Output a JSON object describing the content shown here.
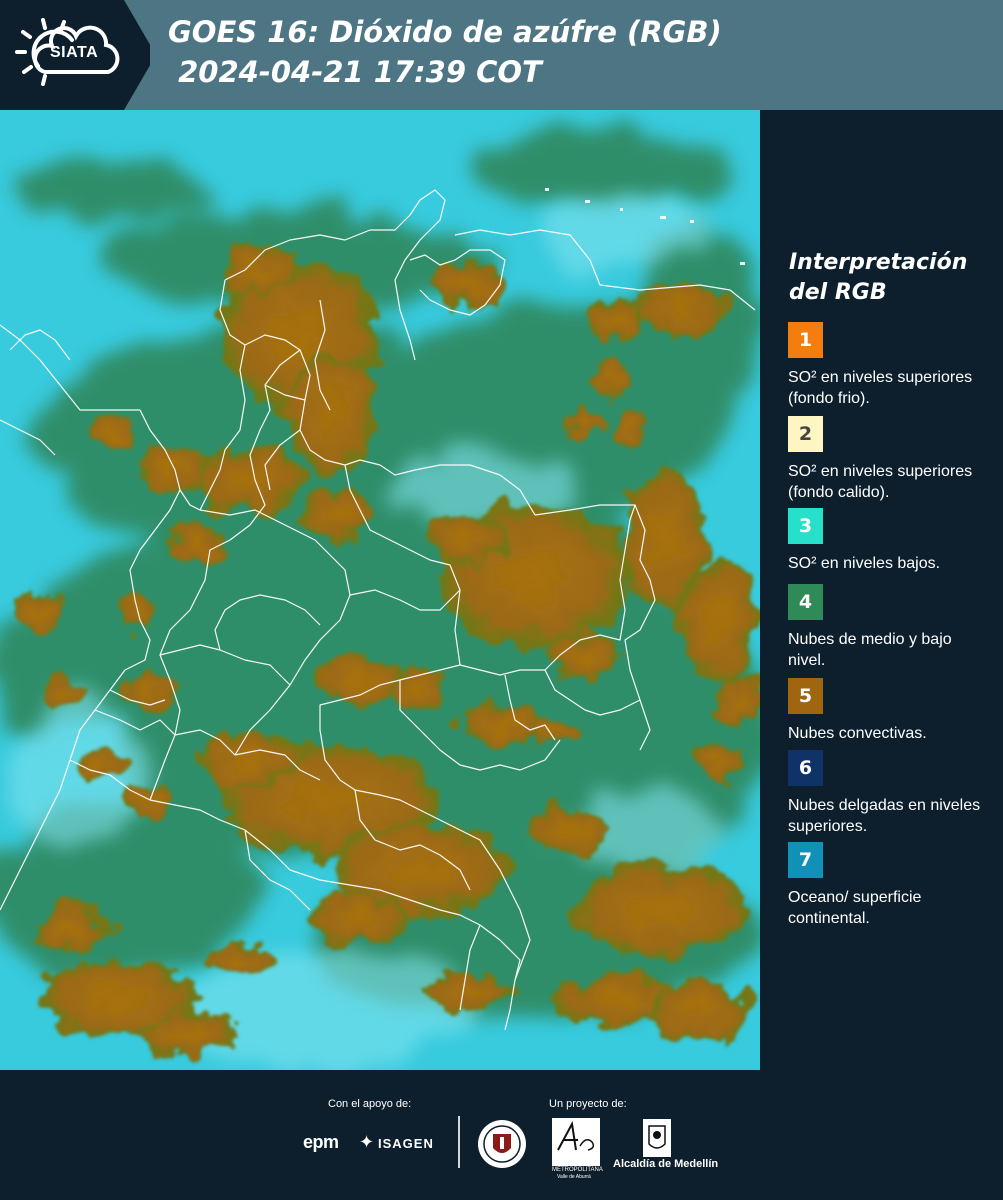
{
  "header": {
    "logo_text": "SIATA",
    "title": "GOES 16: Dióxido de azúfre (RGB)\n 2024-04-21 17:39 COT"
  },
  "legend": {
    "title": "Interpretación del RGB",
    "items": [
      {
        "number": "1",
        "color": "#f57c0f",
        "text": "SO² en niveles superiores (fondo frio)."
      },
      {
        "number": "2",
        "color": "#fdf6c3",
        "text": "SO² en niveles superiores (fondo calido)."
      },
      {
        "number": "3",
        "color": "#26e0c9",
        "text": "SO² en niveles bajos."
      },
      {
        "number": "4",
        "color": "#2e8b57",
        "text": "Nubes de medio y bajo nivel."
      },
      {
        "number": "5",
        "color": "#a0650f",
        "text": "Nubes convectivas."
      },
      {
        "number": "6",
        "color": "#0f3367",
        "text": "Nubes delgadas en niveles superiores."
      },
      {
        "number": "7",
        "color": "#1190b8",
        "text": "Oceano/ superficie continental."
      }
    ]
  },
  "footer": {
    "support_label": "Con el apoyo de:",
    "project_label": "Un proyecto de:",
    "sponsors": [
      "epm",
      "ISAGEN"
    ],
    "partners": [
      "METROPOLITANA",
      "Valle de Aburrá",
      "Alcaldía de Medellín"
    ]
  },
  "colors": {
    "header_bg": "#4e7583",
    "panel_bg": "#0d1f2d",
    "map_sky": "#35c9dc",
    "cloud_convective": "#a0650f",
    "cloud_low": "#2e8b57"
  }
}
